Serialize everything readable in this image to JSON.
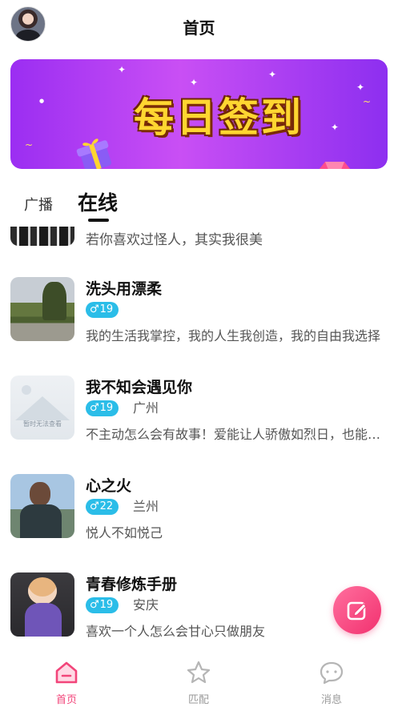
{
  "header": {
    "title": "首页",
    "avatar": "user-avatar"
  },
  "banner": {
    "title": "每日签到",
    "icons": [
      "gift-icon",
      "diamond-icon"
    ],
    "colors": {
      "bg_start": "#9b2ef2",
      "bg_end": "#8d2ff0",
      "text": "#ffd631"
    }
  },
  "tabs": [
    {
      "label": "广播",
      "active": false
    },
    {
      "label": "在线",
      "active": true
    }
  ],
  "partial_item": {
    "bio": "若你喜欢过怪人，其实我很美"
  },
  "users": [
    {
      "name": "洗头用漂柔",
      "age": "19",
      "city": "",
      "bio": "我的生活我掌控，我的人生我创造，我的自由我选择"
    },
    {
      "name": "我不知会遇见你",
      "age": "19",
      "city": "广州",
      "bio": "不主动怎么会有故事！爱能让人骄傲如烈日，也能让人卑微如尘埃",
      "placeholder_text": "暂时无法查看"
    },
    {
      "name": "心之火",
      "age": "22",
      "city": "兰州",
      "bio": "悦人不如悦己"
    },
    {
      "name": "青春修炼手册",
      "age": "19",
      "city": "安庆",
      "bio": "喜欢一个人怎么会甘心只做朋友"
    }
  ],
  "gender_icon": "♂",
  "fab": {
    "icon": "edit-icon"
  },
  "bottom_nav": [
    {
      "label": "首页",
      "icon": "home-icon",
      "active": true
    },
    {
      "label": "匹配",
      "icon": "star-icon",
      "active": false
    },
    {
      "label": "消息",
      "icon": "message-icon",
      "active": false
    }
  ],
  "colors": {
    "accent": "#f2457a",
    "badge": "#2bbde8",
    "inactive": "#9a9a9a"
  }
}
